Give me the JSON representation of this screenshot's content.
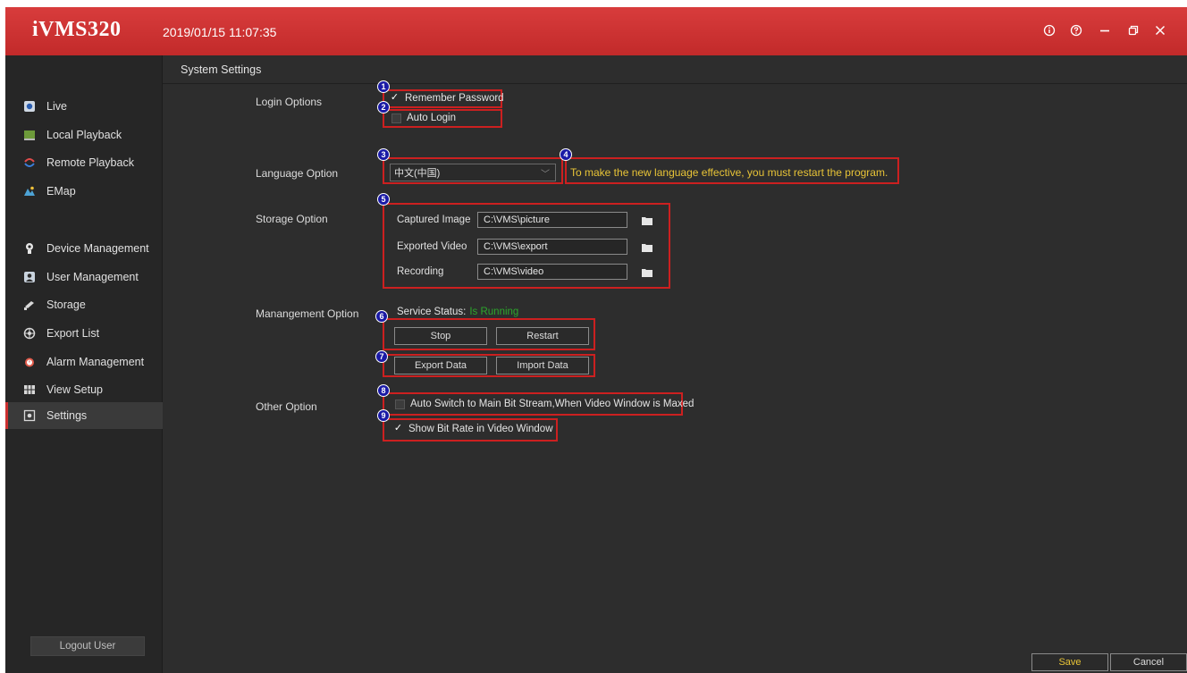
{
  "app": {
    "title": "iVMS320",
    "datetime": "2019/01/15 11:07:35",
    "accent": "#c8302f"
  },
  "window_controls": {
    "info_icon": "info-icon",
    "help_icon": "help-icon",
    "minimize_icon": "minimize-icon",
    "restore_icon": "restore-icon",
    "close_icon": "close-icon"
  },
  "sidebar": {
    "items": [
      {
        "label": "Live",
        "icon": "live-icon"
      },
      {
        "label": "Local Playback",
        "icon": "local-playback-icon"
      },
      {
        "label": "Remote Playback",
        "icon": "remote-playback-icon"
      },
      {
        "label": "EMap",
        "icon": "emap-icon"
      },
      {
        "label": "Device Management",
        "icon": "device-management-icon"
      },
      {
        "label": "User Management",
        "icon": "user-management-icon"
      },
      {
        "label": "Storage",
        "icon": "storage-icon"
      },
      {
        "label": "Export List",
        "icon": "export-list-icon"
      },
      {
        "label": "Alarm Management",
        "icon": "alarm-icon"
      },
      {
        "label": "View Setup",
        "icon": "view-setup-icon"
      },
      {
        "label": "Settings",
        "icon": "settings-icon",
        "active": true
      }
    ],
    "logout_label": "Logout User"
  },
  "main": {
    "section_title": "System Settings",
    "login": {
      "label": "Login Options",
      "remember_password": {
        "label": "Remember Password",
        "checked": true
      },
      "auto_login": {
        "label": "Auto Login",
        "checked": false
      }
    },
    "language": {
      "label": "Language Option",
      "selected": "中文(中国)",
      "note": "To make the new language effective, you must restart the program."
    },
    "storage": {
      "label": "Storage Option",
      "rows": [
        {
          "label": "Captured Image",
          "path": "C:\\VMS\\picture"
        },
        {
          "label": "Exported Video",
          "path": "C:\\VMS\\export"
        },
        {
          "label": "Recording",
          "path": "C:\\VMS\\video"
        }
      ]
    },
    "management": {
      "label": "Manangement Option",
      "service_status_label": "Service Status:",
      "service_status_value": "Is Running",
      "stop_label": "Stop",
      "restart_label": "Restart",
      "export_label": "Export Data",
      "import_label": "Import Data"
    },
    "other": {
      "label": "Other Option",
      "auto_switch": {
        "label": "Auto Switch to Main Bit Stream,When Video Window is Maxed",
        "checked": false
      },
      "show_bit_rate": {
        "label": "Show Bit Rate in Video Window",
        "checked": true
      }
    },
    "markers": [
      "1",
      "2",
      "3",
      "4",
      "5",
      "6",
      "7",
      "8",
      "9"
    ]
  },
  "footer": {
    "save_label": "Save",
    "cancel_label": "Cancel",
    "save_color": "#e8c437"
  }
}
